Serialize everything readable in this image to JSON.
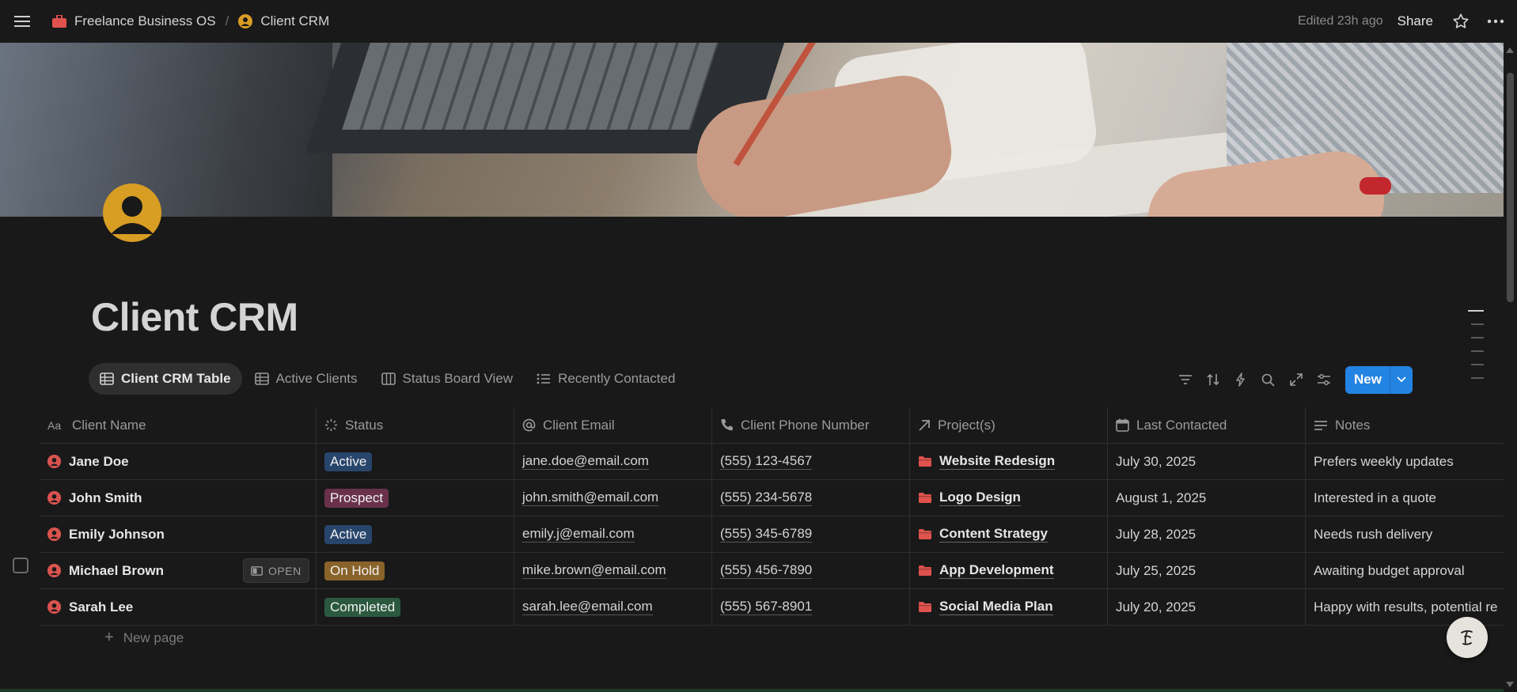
{
  "topbar": {
    "workspace": "Freelance Business OS",
    "page": "Client CRM",
    "edited": "Edited 23h ago",
    "share": "Share"
  },
  "page": {
    "title": "Client CRM"
  },
  "views": [
    {
      "label": "Client CRM Table",
      "icon": "table-icon",
      "active": true
    },
    {
      "label": "Active Clients",
      "icon": "table-icon"
    },
    {
      "label": "Status Board View",
      "icon": "board-icon"
    },
    {
      "label": "Recently Contacted",
      "icon": "list-icon"
    }
  ],
  "toolbar": {
    "new_label": "New"
  },
  "table": {
    "columns": [
      {
        "label": "Client Name",
        "icon": "text-icon"
      },
      {
        "label": "Status",
        "icon": "status-icon"
      },
      {
        "label": "Client Email",
        "icon": "at-icon"
      },
      {
        "label": "Client Phone Number",
        "icon": "phone-icon"
      },
      {
        "label": "Project(s)",
        "icon": "relation-arrow-icon"
      },
      {
        "label": "Last Contacted",
        "icon": "calendar-icon"
      },
      {
        "label": "Notes",
        "icon": "notes-icon"
      }
    ],
    "rows": [
      {
        "name": "Jane Doe",
        "status": "Active",
        "email": "jane.doe@email.com",
        "phone": "(555) 123-4567",
        "project": "Website Redesign",
        "last": "July 30, 2025",
        "notes": "Prefers weekly updates"
      },
      {
        "name": "John Smith",
        "status": "Prospect",
        "email": "john.smith@email.com",
        "phone": "(555) 234-5678",
        "project": "Logo Design",
        "last": "August 1, 2025",
        "notes": "Interested in a quote"
      },
      {
        "name": "Emily Johnson",
        "status": "Active",
        "email": "emily.j@email.com",
        "phone": "(555) 345-6789",
        "project": "Content Strategy",
        "last": "July 28, 2025",
        "notes": "Needs rush delivery"
      },
      {
        "name": "Michael Brown",
        "status": "On Hold",
        "email": "mike.brown@email.com",
        "phone": "(555) 456-7890",
        "project": "App Development",
        "last": "July 25, 2025",
        "notes": "Awaiting budget approval"
      },
      {
        "name": "Sarah Lee",
        "status": "Completed",
        "email": "sarah.lee@email.com",
        "phone": "(555) 567-8901",
        "project": "Social Media Plan",
        "last": "July 20, 2025",
        "notes": "Happy with results, potential re"
      }
    ],
    "open_label": "OPEN",
    "new_page": "New page"
  },
  "colors": {
    "Active": "#28456c",
    "Prospect": "#69314c",
    "On Hold": "#89632a",
    "Completed": "#2b593f",
    "accent": "#2383e2",
    "page_icon": "#d89d23",
    "person_icon": "#d9534f",
    "folder_icon": "#e0524d"
  }
}
